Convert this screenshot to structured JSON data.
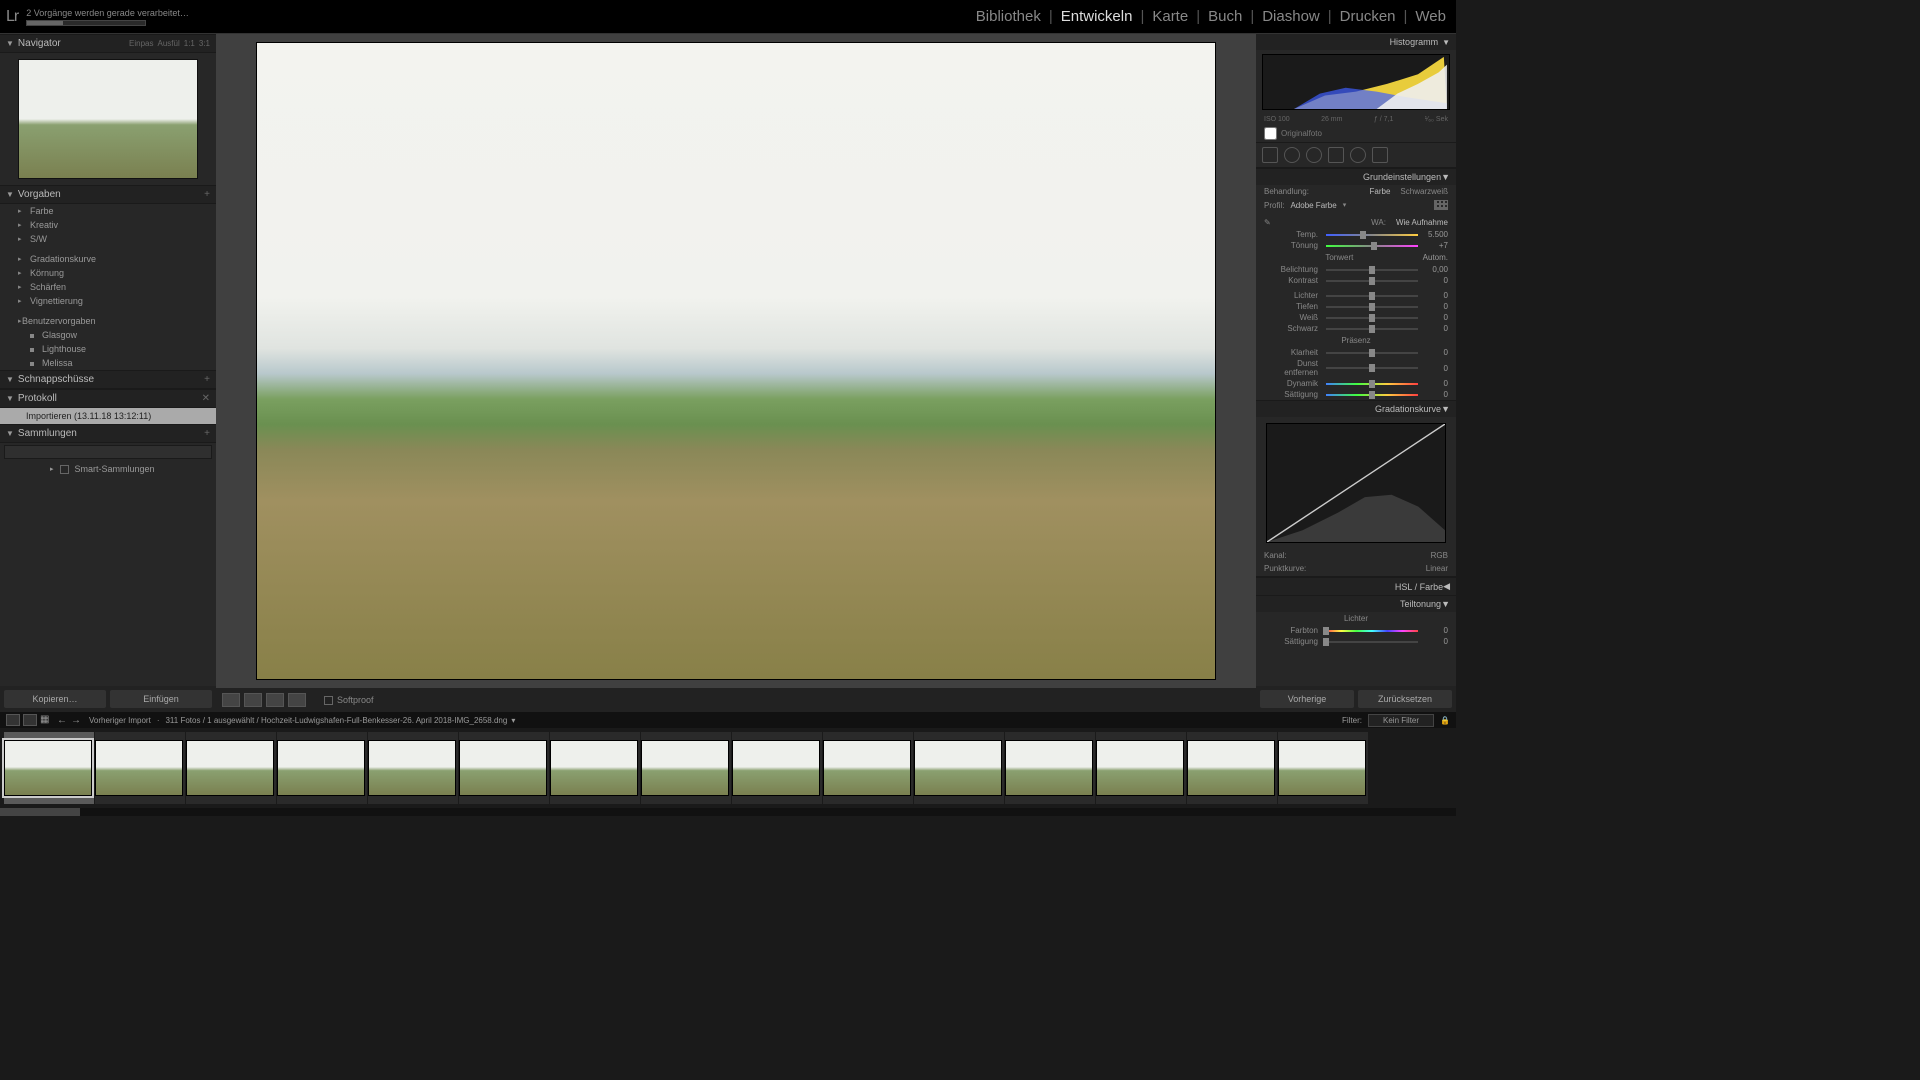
{
  "header": {
    "logo": "Lr",
    "status": "2 Vorgänge werden gerade verarbeitet…",
    "modules": [
      "Bibliothek",
      "Entwickeln",
      "Karte",
      "Buch",
      "Diashow",
      "Drucken",
      "Web"
    ],
    "active_module": "Entwickeln"
  },
  "left": {
    "navigator": {
      "title": "Navigator",
      "zoom": [
        "Einpas",
        "Ausfül",
        "1:1",
        "3:1"
      ]
    },
    "presets": {
      "title": "Vorgaben",
      "groups": [
        "Farbe",
        "Kreativ",
        "S/W"
      ],
      "groups2": [
        "Gradationskurve",
        "Körnung",
        "Schärfen",
        "Vignettierung"
      ],
      "user_group": "Benutzervorgaben",
      "user_presets": [
        "Glasgow",
        "Lighthouse",
        "Melissa"
      ]
    },
    "snapshots": {
      "title": "Schnappschüsse"
    },
    "protocol": {
      "title": "Protokoll",
      "item": "Importieren (13.11.18 13:12:11)"
    },
    "collections": {
      "title": "Sammlungen",
      "smart": "Smart-Sammlungen"
    },
    "copy_btn": "Kopieren…",
    "paste_btn": "Einfügen"
  },
  "toolbar": {
    "softproof": "Softproof"
  },
  "right": {
    "histogram": {
      "title": "Histogramm",
      "iso": "ISO 100",
      "focal": "26 mm",
      "aperture": "ƒ / 7,1",
      "shutter": "¹⁄₆₀ Sek",
      "original": "Originalfoto"
    },
    "basic": {
      "title": "Grundeinstellungen",
      "treatment_label": "Behandlung:",
      "treatment_color": "Farbe",
      "treatment_bw": "Schwarzweiß",
      "profile_label": "Profil:",
      "profile_value": "Adobe Farbe",
      "wb_label": "WA:",
      "wb_value": "Wie Aufnahme",
      "temp": {
        "label": "Temp.",
        "value": "5.500"
      },
      "tint": {
        "label": "Tönung",
        "value": "+7"
      },
      "tone_hdr": "Tonwert",
      "tone_auto": "Autom.",
      "exposure": {
        "label": "Belichtung",
        "value": "0,00"
      },
      "contrast": {
        "label": "Kontrast",
        "value": "0"
      },
      "highlights": {
        "label": "Lichter",
        "value": "0"
      },
      "shadows": {
        "label": "Tiefen",
        "value": "0"
      },
      "whites": {
        "label": "Weiß",
        "value": "0"
      },
      "blacks": {
        "label": "Schwarz",
        "value": "0"
      },
      "presence_hdr": "Präsenz",
      "clarity": {
        "label": "Klarheit",
        "value": "0"
      },
      "dehaze": {
        "label": "Dunst entfernen",
        "value": "0"
      },
      "vibrance": {
        "label": "Dynamik",
        "value": "0"
      },
      "saturation": {
        "label": "Sättigung",
        "value": "0"
      }
    },
    "curve": {
      "title": "Gradationskurve",
      "channel_label": "Kanal:",
      "channel_value": "RGB",
      "point_label": "Punktkurve:",
      "point_value": "Linear"
    },
    "hsl": {
      "title": "HSL / Farbe"
    },
    "split": {
      "title": "Teiltonung",
      "highlights": "Lichter",
      "hue": {
        "label": "Farbton",
        "value": "0"
      },
      "sat": {
        "label": "Sättigung",
        "value": "0"
      }
    },
    "prev_btn": "Vorherige",
    "reset_btn": "Zurücksetzen"
  },
  "info": {
    "source_label": "Vorheriger Import",
    "count": "311 Fotos",
    "selected": "1 ausgewählt",
    "filename": "Hochzeit-Ludwigshafen-Full-Benkesser-26. April 2018-IMG_2658.dng",
    "filter_label": "Filter:",
    "filter_value": "Kein Filter"
  },
  "filmstrip": {
    "count": 15,
    "selected_index": 0
  }
}
